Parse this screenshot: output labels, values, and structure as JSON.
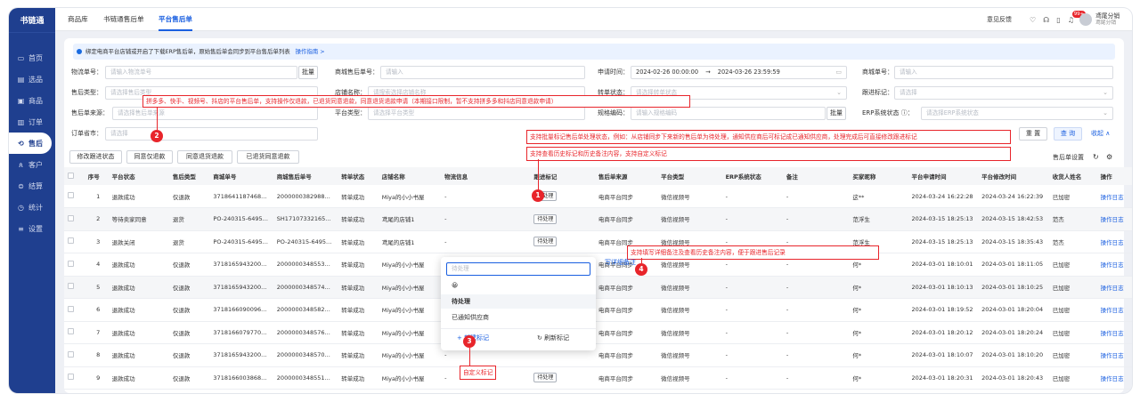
{
  "app": {
    "logo": "书链通",
    "logo_sub": "SHU LIAN TONG"
  },
  "sidebar": {
    "items": [
      {
        "label": "首页",
        "icon": "home-icon",
        "glyph": "▭"
      },
      {
        "label": "选品",
        "icon": "picking-icon",
        "glyph": "▤"
      },
      {
        "label": "商品",
        "icon": "goods-icon",
        "glyph": "▣"
      },
      {
        "label": "订单",
        "icon": "order-icon",
        "glyph": "▥"
      },
      {
        "label": "售后",
        "icon": "aftersale-icon",
        "glyph": "⟲",
        "active": true
      },
      {
        "label": "客户",
        "icon": "customer-icon",
        "glyph": "ጰ"
      },
      {
        "label": "结算",
        "icon": "settle-icon",
        "glyph": "⊜"
      },
      {
        "label": "统计",
        "icon": "stats-icon",
        "glyph": "◷"
      },
      {
        "label": "设置",
        "icon": "settings-icon",
        "glyph": "≡"
      }
    ]
  },
  "topbar": {
    "tabs": [
      "商品库",
      "书链通售后单",
      "平台售后单"
    ],
    "active_tab": 2,
    "feedback": "意见反馈",
    "badge": "99+",
    "user_name": "鸢尾分销",
    "user_sub": "鸢尾分销"
  },
  "notice": {
    "text": "绑定电商平台店铺或开启了下载ERP售后单，原始售后单会同步到平台售后单列表",
    "link": "操作指南 >"
  },
  "filters": {
    "logistics_no": {
      "label": "物流单号：",
      "placeholder": "请输入物流单号",
      "batch": "批量"
    },
    "shop_aftersale_no": {
      "label": "商城售后单号：",
      "placeholder": "请输入"
    },
    "apply_time": {
      "label": "申请时间：",
      "start": "2024-02-26 00:00:00",
      "sep": "→",
      "end": "2024-03-26 23:59:59"
    },
    "mall_order_no": {
      "label": "商城单号：",
      "placeholder": "请输入"
    },
    "aftersale_type": {
      "label": "售后类型：",
      "placeholder": "请选择售后类型"
    },
    "shop_name": {
      "label": "店铺名称：",
      "placeholder": "请搜索选择店铺名称"
    },
    "transfer_status": {
      "label": "转单状态：",
      "placeholder": "请选择转单状态"
    },
    "follow_mark": {
      "label": "跟进标记：",
      "placeholder": "请选择"
    },
    "aftersale_source": {
      "label": "售后单来源：",
      "placeholder": "请选择售后单来源"
    },
    "platform_type": {
      "label": "平台类型：",
      "placeholder": "请选择平台类型"
    },
    "spec_code": {
      "label": "规格编码：",
      "placeholder": "请输入规格编码",
      "batch": "批量"
    },
    "erp_status": {
      "label": "ERP系统状态",
      "placeholder": "请选择ERP系统状态"
    },
    "order_province": {
      "label": "订单省市：",
      "placeholder": "请选择"
    },
    "reset": "重 置",
    "search": "查 询",
    "collapse": "收起 ∧"
  },
  "actions": [
    "修改跟进状态",
    "同意仅退款",
    "同意退货退款",
    "已退货同意退款"
  ],
  "table_settings": "售后单设置",
  "table": {
    "headers": [
      "",
      "序号",
      "平台状态",
      "售后类型",
      "商城单号",
      "商城售后单号",
      "转单状态",
      "店铺名称",
      "物流信息",
      "跟进标记",
      "售后单来源",
      "平台类型",
      "ERP系统状态",
      "备注",
      "买家昵称",
      "平台申请时间",
      "平台修改时间",
      "收货人姓名",
      "操作"
    ],
    "rows": [
      [
        "",
        "1",
        "退款成功",
        "仅退款",
        "3718641187468...",
        "2000000382988...",
        "转单成功",
        "Miya的小小书屋",
        "-",
        "待处理",
        "电商平台同步",
        "微信视频号",
        "-",
        "-",
        "这**",
        "2024-03-24 16:22:28",
        "2024-03-24 16:22:39",
        "已加密",
        "操作日志"
      ],
      [
        "",
        "2",
        "等待卖家同意",
        "退货",
        "PO-240315-6495...",
        "SH17107332165...",
        "转单成功",
        "鸢尾的店铺1",
        "-",
        "待处理",
        "电商平台同步",
        "微信视频号",
        "-",
        "-",
        "范浮生",
        "2024-03-15 18:25:13",
        "2024-03-15 18:42:53",
        "范杰",
        "操作日志"
      ],
      [
        "",
        "3",
        "退款关闭",
        "退货",
        "PO-240315-6495...",
        "PO-240315-6495...",
        "转单成功",
        "鸢尾的店铺1",
        "-",
        "待处理",
        "电商平台同步",
        "微信视频号",
        "-",
        "-",
        "范浮生",
        "2024-03-15 18:25:13",
        "2024-03-15 18:35:43",
        "范杰",
        "操作日志"
      ],
      [
        "",
        "4",
        "退款成功",
        "仅退款",
        "3718165943200...",
        "2000000348553...",
        "转单成功",
        "Miya的小小书屋",
        "-",
        "",
        "电商平台同步",
        "微信视频号",
        "-",
        "-",
        "何*",
        "2024-03-01 18:10:01",
        "2024-03-01 18:11:05",
        "已加密",
        "操作日志"
      ],
      [
        "",
        "5",
        "退款成功",
        "仅退款",
        "3718165943200...",
        "2000000348574...",
        "转单成功",
        "Miya的小小书屋",
        "-",
        "",
        "电商平台同步",
        "微信视频号",
        "-",
        "-",
        "何*",
        "2024-03-01 18:10:13",
        "2024-03-01 18:10:25",
        "已加密",
        "操作日志"
      ],
      [
        "",
        "6",
        "退款成功",
        "仅退款",
        "3718166090096...",
        "2000000348582...",
        "转单成功",
        "Miya的小小书屋",
        "-",
        "",
        "电商平台同步",
        "微信视频号",
        "-",
        "-",
        "何*",
        "2024-03-01 18:19:52",
        "2024-03-01 18:20:04",
        "已加密",
        "操作日志"
      ],
      [
        "",
        "7",
        "退款成功",
        "仅退款",
        "3718166079770...",
        "2000000348576...",
        "转单成功",
        "Miya的小小书屋",
        "-",
        "",
        "电商平台同步",
        "微信视频号",
        "-",
        "-",
        "何*",
        "2024-03-01 18:20:12",
        "2024-03-01 18:20:24",
        "已加密",
        "操作日志"
      ],
      [
        "",
        "8",
        "退款成功",
        "仅退款",
        "3718165943200...",
        "2000000348570...",
        "转单成功",
        "Miya的小小书屋",
        "-",
        "",
        "电商平台同步",
        "微信视频号",
        "-",
        "-",
        "何*",
        "2024-03-01 18:10:07",
        "2024-03-01 18:10:20",
        "已加密",
        "操作日志"
      ],
      [
        "",
        "9",
        "退款成功",
        "仅退款",
        "3718166003868...",
        "2000000348551...",
        "转单成功",
        "Miya的小小书屋",
        "-",
        "待处理",
        "电商平台同步",
        "微信视频号",
        "-",
        "-",
        "何*",
        "2024-03-01 18:20:31",
        "2024-03-01 18:20:43",
        "已加密",
        "操作日志"
      ]
    ]
  },
  "dropdown": {
    "placeholder": "待处理",
    "note_link": "写详细备注",
    "emoji": "😀",
    "options": [
      "待处理",
      "已通知供应商"
    ],
    "new_tag": "+ 新建标记",
    "refresh": "刷新标记"
  },
  "annotations": {
    "a2": "拼多多、快手、视频号、抖店的平台售后单，支持操作仅退款，已退货同意退款，同意退货退款申请（本期接口限制，暂不支持拼多多和抖店同意退款申请）",
    "a1a": "支持批量标记售后单处理状态，例如：从店铺同步下来新的售后单为待处理，通知供应商后可标记成已通知供应商，处理完成后可直接修改跟进标记",
    "a1b": "支持查看历史标记和历史备注内容，支持自定义标记",
    "a4": "支持填写详细备注及查看历史备注内容，便于跟进售后记录",
    "a3": "自定义标记",
    "n1": "1",
    "n2": "2",
    "n3": "3",
    "n4": "4"
  }
}
